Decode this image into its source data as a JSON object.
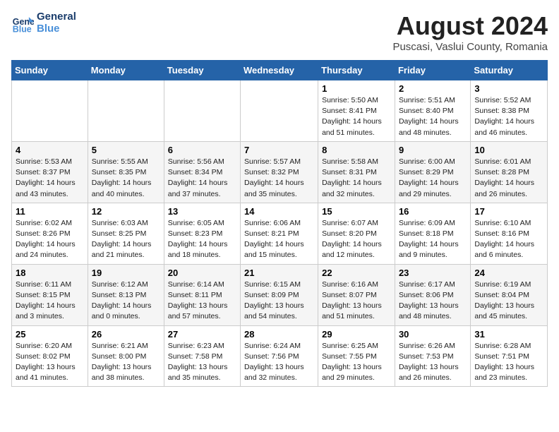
{
  "logo": {
    "line1": "General",
    "line2": "Blue"
  },
  "title": "August 2024",
  "subtitle": "Puscasi, Vaslui County, Romania",
  "days_of_week": [
    "Sunday",
    "Monday",
    "Tuesday",
    "Wednesday",
    "Thursday",
    "Friday",
    "Saturday"
  ],
  "weeks": [
    [
      {
        "day": "",
        "info": ""
      },
      {
        "day": "",
        "info": ""
      },
      {
        "day": "",
        "info": ""
      },
      {
        "day": "",
        "info": ""
      },
      {
        "day": "1",
        "info": "Sunrise: 5:50 AM\nSunset: 8:41 PM\nDaylight: 14 hours\nand 51 minutes."
      },
      {
        "day": "2",
        "info": "Sunrise: 5:51 AM\nSunset: 8:40 PM\nDaylight: 14 hours\nand 48 minutes."
      },
      {
        "day": "3",
        "info": "Sunrise: 5:52 AM\nSunset: 8:38 PM\nDaylight: 14 hours\nand 46 minutes."
      }
    ],
    [
      {
        "day": "4",
        "info": "Sunrise: 5:53 AM\nSunset: 8:37 PM\nDaylight: 14 hours\nand 43 minutes."
      },
      {
        "day": "5",
        "info": "Sunrise: 5:55 AM\nSunset: 8:35 PM\nDaylight: 14 hours\nand 40 minutes."
      },
      {
        "day": "6",
        "info": "Sunrise: 5:56 AM\nSunset: 8:34 PM\nDaylight: 14 hours\nand 37 minutes."
      },
      {
        "day": "7",
        "info": "Sunrise: 5:57 AM\nSunset: 8:32 PM\nDaylight: 14 hours\nand 35 minutes."
      },
      {
        "day": "8",
        "info": "Sunrise: 5:58 AM\nSunset: 8:31 PM\nDaylight: 14 hours\nand 32 minutes."
      },
      {
        "day": "9",
        "info": "Sunrise: 6:00 AM\nSunset: 8:29 PM\nDaylight: 14 hours\nand 29 minutes."
      },
      {
        "day": "10",
        "info": "Sunrise: 6:01 AM\nSunset: 8:28 PM\nDaylight: 14 hours\nand 26 minutes."
      }
    ],
    [
      {
        "day": "11",
        "info": "Sunrise: 6:02 AM\nSunset: 8:26 PM\nDaylight: 14 hours\nand 24 minutes."
      },
      {
        "day": "12",
        "info": "Sunrise: 6:03 AM\nSunset: 8:25 PM\nDaylight: 14 hours\nand 21 minutes."
      },
      {
        "day": "13",
        "info": "Sunrise: 6:05 AM\nSunset: 8:23 PM\nDaylight: 14 hours\nand 18 minutes."
      },
      {
        "day": "14",
        "info": "Sunrise: 6:06 AM\nSunset: 8:21 PM\nDaylight: 14 hours\nand 15 minutes."
      },
      {
        "day": "15",
        "info": "Sunrise: 6:07 AM\nSunset: 8:20 PM\nDaylight: 14 hours\nand 12 minutes."
      },
      {
        "day": "16",
        "info": "Sunrise: 6:09 AM\nSunset: 8:18 PM\nDaylight: 14 hours\nand 9 minutes."
      },
      {
        "day": "17",
        "info": "Sunrise: 6:10 AM\nSunset: 8:16 PM\nDaylight: 14 hours\nand 6 minutes."
      }
    ],
    [
      {
        "day": "18",
        "info": "Sunrise: 6:11 AM\nSunset: 8:15 PM\nDaylight: 14 hours\nand 3 minutes."
      },
      {
        "day": "19",
        "info": "Sunrise: 6:12 AM\nSunset: 8:13 PM\nDaylight: 14 hours\nand 0 minutes."
      },
      {
        "day": "20",
        "info": "Sunrise: 6:14 AM\nSunset: 8:11 PM\nDaylight: 13 hours\nand 57 minutes."
      },
      {
        "day": "21",
        "info": "Sunrise: 6:15 AM\nSunset: 8:09 PM\nDaylight: 13 hours\nand 54 minutes."
      },
      {
        "day": "22",
        "info": "Sunrise: 6:16 AM\nSunset: 8:07 PM\nDaylight: 13 hours\nand 51 minutes."
      },
      {
        "day": "23",
        "info": "Sunrise: 6:17 AM\nSunset: 8:06 PM\nDaylight: 13 hours\nand 48 minutes."
      },
      {
        "day": "24",
        "info": "Sunrise: 6:19 AM\nSunset: 8:04 PM\nDaylight: 13 hours\nand 45 minutes."
      }
    ],
    [
      {
        "day": "25",
        "info": "Sunrise: 6:20 AM\nSunset: 8:02 PM\nDaylight: 13 hours\nand 41 minutes."
      },
      {
        "day": "26",
        "info": "Sunrise: 6:21 AM\nSunset: 8:00 PM\nDaylight: 13 hours\nand 38 minutes."
      },
      {
        "day": "27",
        "info": "Sunrise: 6:23 AM\nSunset: 7:58 PM\nDaylight: 13 hours\nand 35 minutes."
      },
      {
        "day": "28",
        "info": "Sunrise: 6:24 AM\nSunset: 7:56 PM\nDaylight: 13 hours\nand 32 minutes."
      },
      {
        "day": "29",
        "info": "Sunrise: 6:25 AM\nSunset: 7:55 PM\nDaylight: 13 hours\nand 29 minutes."
      },
      {
        "day": "30",
        "info": "Sunrise: 6:26 AM\nSunset: 7:53 PM\nDaylight: 13 hours\nand 26 minutes."
      },
      {
        "day": "31",
        "info": "Sunrise: 6:28 AM\nSunset: 7:51 PM\nDaylight: 13 hours\nand 23 minutes."
      }
    ]
  ]
}
